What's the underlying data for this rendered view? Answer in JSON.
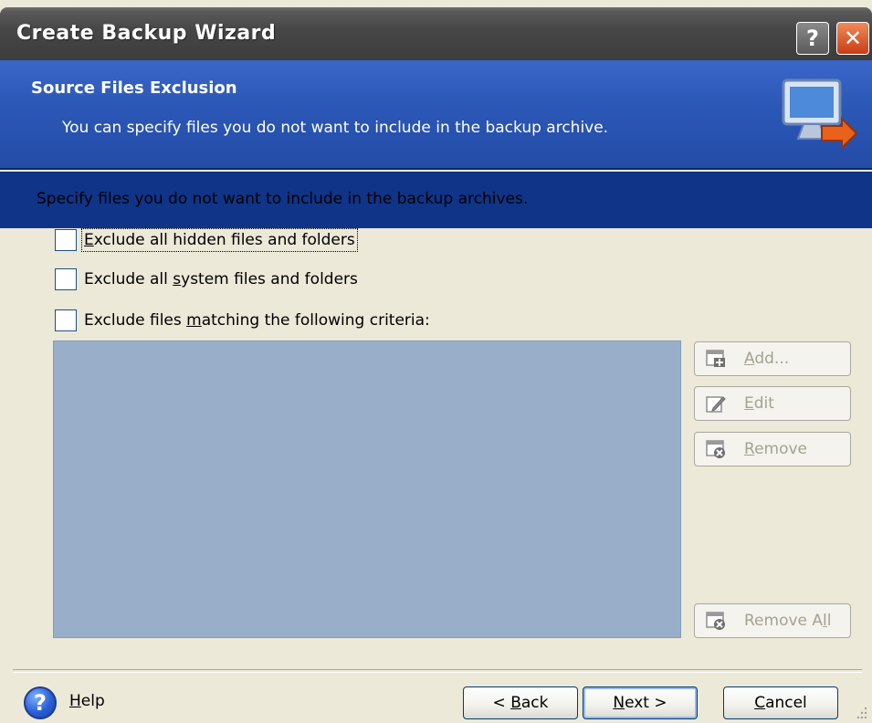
{
  "window": {
    "title": "Create Backup Wizard"
  },
  "titlebar_buttons": {
    "help": "?",
    "close": "✕"
  },
  "header": {
    "title": "Source Files Exclusion",
    "description": "You can specify files you do not want to include in the backup archive.",
    "icon": "monitor-arrow-icon"
  },
  "body": {
    "intro": "Specify files you do not want to include in the backup archives.",
    "options": [
      {
        "pre": "",
        "accel": "E",
        "post": "xclude all hidden files and folders",
        "checked": false
      },
      {
        "pre": "Exclude all ",
        "accel": "s",
        "post": "ystem files and folders",
        "checked": false
      },
      {
        "pre": "Exclude files ",
        "accel": "m",
        "post": "atching the following criteria:",
        "checked": false
      }
    ],
    "criteria_list_color": "#99aec8"
  },
  "side_buttons": {
    "add": {
      "accel": "A",
      "post": "dd...",
      "icon": "add-icon",
      "enabled": false
    },
    "edit": {
      "accel": "E",
      "post": "dit",
      "icon": "edit-icon",
      "enabled": false
    },
    "remove": {
      "accel": "R",
      "post": "emove",
      "icon": "remove-icon",
      "enabled": false
    },
    "remove_all": {
      "pre": "Remove A",
      "accel": "l",
      "post": "l",
      "icon": "remove-all-icon",
      "enabled": false
    }
  },
  "footer": {
    "help": {
      "accel": "H",
      "post": "elp",
      "icon": "?"
    },
    "back": {
      "pre": "< ",
      "accel": "B",
      "post": "ack"
    },
    "next": {
      "accel": "N",
      "post": "ext >"
    },
    "cancel": {
      "accel": "C",
      "post": "ancel"
    }
  },
  "colors": {
    "header_blue": "#2c58b8",
    "header_dark": "#0f3488",
    "titlebar_gray": "#474747",
    "dialog_bg": "#ece9d8",
    "disabled_text": "#a5a291"
  }
}
